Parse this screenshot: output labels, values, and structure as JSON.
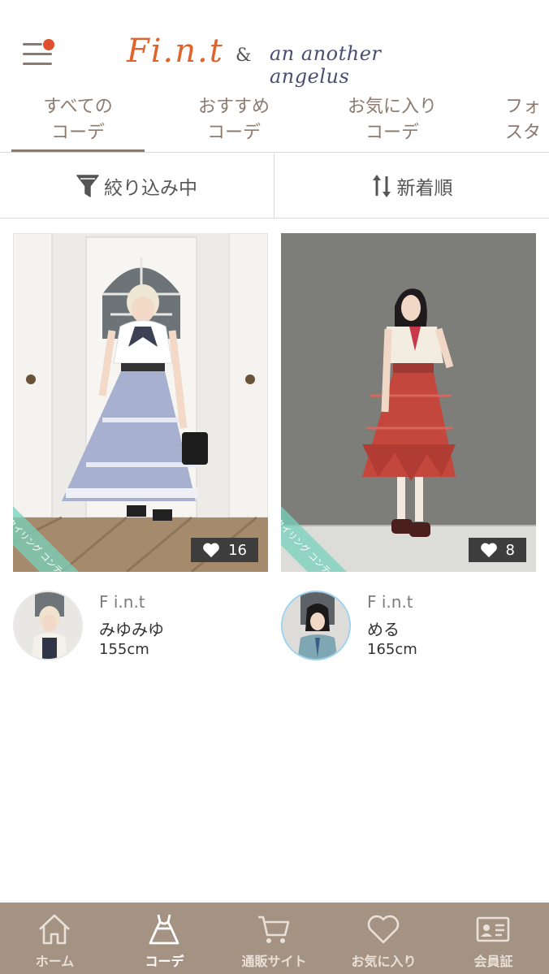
{
  "header": {
    "logo_fint": "Fi.n.t",
    "logo_amp": "&",
    "logo_brand2": "an another angelus"
  },
  "tabs": [
    {
      "line1": "すべての",
      "line2": "コーデ"
    },
    {
      "line1": "おすすめ",
      "line2": "コーデ"
    },
    {
      "line1": "お気に入り",
      "line2": "コーデ"
    },
    {
      "line1": "フォ",
      "line2": "スタ"
    }
  ],
  "toolbar": {
    "filter_label": "絞り込み中",
    "sort_label": "新着順"
  },
  "posts": [
    {
      "badge": "スタイリング コンテスト",
      "likes": "16",
      "brand": "F i.n.t",
      "name": "みゆみゆ",
      "height": "155cm"
    },
    {
      "badge": "スタイリング コンテスト",
      "likes": "8",
      "brand": "F i.n.t",
      "name": "める",
      "height": "165cm"
    }
  ],
  "nav": [
    {
      "label": "ホーム",
      "icon": "home-icon"
    },
    {
      "label": "コーデ",
      "icon": "dress-icon"
    },
    {
      "label": "通販サイト",
      "icon": "cart-icon"
    },
    {
      "label": "お気に入り",
      "icon": "heart-icon"
    },
    {
      "label": "会員証",
      "icon": "member-card-icon"
    }
  ],
  "colors": {
    "accent": "#8c7a6e",
    "nav_bg": "#a49282",
    "logo_orange": "#e0632c",
    "notify_dot": "#e0502f"
  }
}
